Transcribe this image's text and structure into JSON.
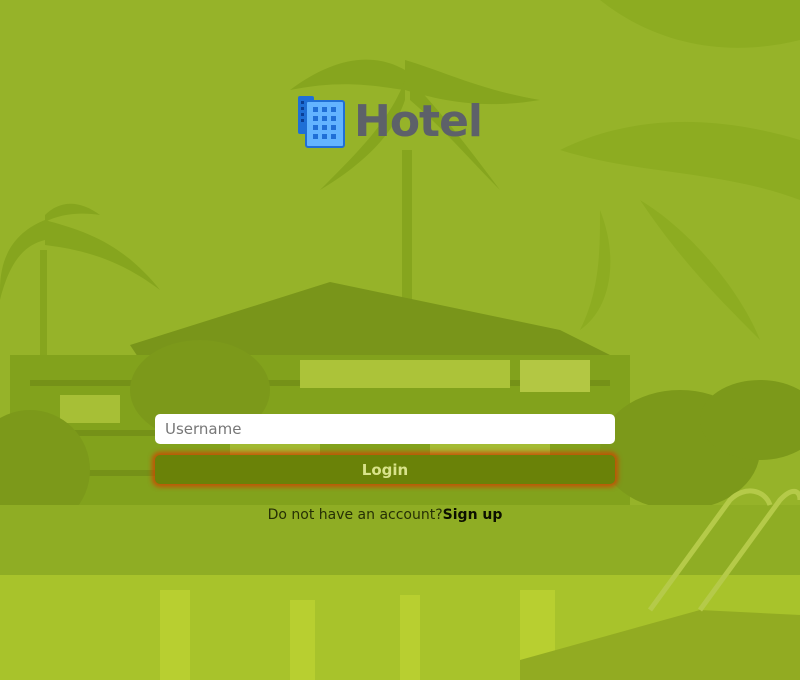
{
  "brand": {
    "title": "Hotel",
    "icon": "hotel-building-icon"
  },
  "form": {
    "username_placeholder": "Username",
    "username_value": "",
    "login_label": "Login"
  },
  "signup": {
    "prompt": "Do not have an account?",
    "link_label": "Sign up"
  },
  "colors": {
    "overlay": "#93b02a",
    "login_button": "#6a8208",
    "login_glow": "#cd4600",
    "title": "#5d6169"
  }
}
